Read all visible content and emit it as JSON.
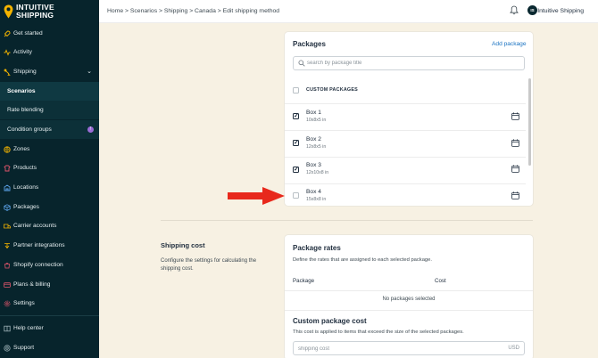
{
  "brand": {
    "line1": "INTUITIVE",
    "line2": "SHIPPING"
  },
  "sidebar": {
    "items": [
      {
        "label": "Get started",
        "icon": "rocket-icon"
      },
      {
        "label": "Activity",
        "icon": "activity-icon"
      },
      {
        "label": "Shipping",
        "icon": "shipping-icon"
      },
      {
        "label": "Scenarios"
      },
      {
        "label": "Rate blending"
      },
      {
        "label": "Condition groups",
        "badge": "!"
      },
      {
        "label": "Zones",
        "icon": "zones-icon"
      },
      {
        "label": "Products",
        "icon": "products-icon"
      },
      {
        "label": "Locations",
        "icon": "locations-icon"
      },
      {
        "label": "Packages",
        "icon": "packages-icon"
      },
      {
        "label": "Carrier accounts",
        "icon": "carrier-icon"
      },
      {
        "label": "Partner integrations",
        "icon": "partner-icon"
      },
      {
        "label": "Shopify connection",
        "icon": "shopify-icon"
      },
      {
        "label": "Plans & billing",
        "icon": "billing-icon"
      },
      {
        "label": "Settings",
        "icon": "settings-icon"
      },
      {
        "label": "Help center",
        "icon": "help-icon"
      },
      {
        "label": "Support",
        "icon": "support-icon"
      }
    ]
  },
  "topbar": {
    "breadcrumb": "Home > Scenarios > Shipping > Canada > Edit shipping method",
    "user_initials": "IS",
    "user_name": "Intuitive Shipping"
  },
  "packages_card": {
    "title": "Packages",
    "add_label": "Add package",
    "search_placeholder": "search by package title",
    "group_label": "CUSTOM PACKAGES",
    "items": [
      {
        "name": "Box 1",
        "dims": "10x8x5 in",
        "checked": true
      },
      {
        "name": "Box 2",
        "dims": "12x8x5 in",
        "checked": true
      },
      {
        "name": "Box 3",
        "dims": "12x10x8 in",
        "checked": true
      },
      {
        "name": "Box 4",
        "dims": "15x8x8 in",
        "checked": false
      }
    ]
  },
  "shipping_cost": {
    "title": "Shipping cost",
    "description": "Configure the settings for calculating the shipping cost."
  },
  "rates_card": {
    "title": "Package rates",
    "subtitle": "Define the rates that are assigned to each selected package.",
    "col_package": "Package",
    "col_cost": "Cost",
    "empty": "No packages selected",
    "custom_title": "Custom package cost",
    "custom_subtitle": "This cost is applied to items that exceed the size of the selected packages.",
    "cost_placeholder": "shipping cost",
    "currency": "USD"
  },
  "colors": {
    "sidebar_bg": "#07242c",
    "page_bg": "#f7f1e3",
    "link": "#1a73c2",
    "arrow": "#e8291c",
    "logo_accent": "#f4b400"
  }
}
